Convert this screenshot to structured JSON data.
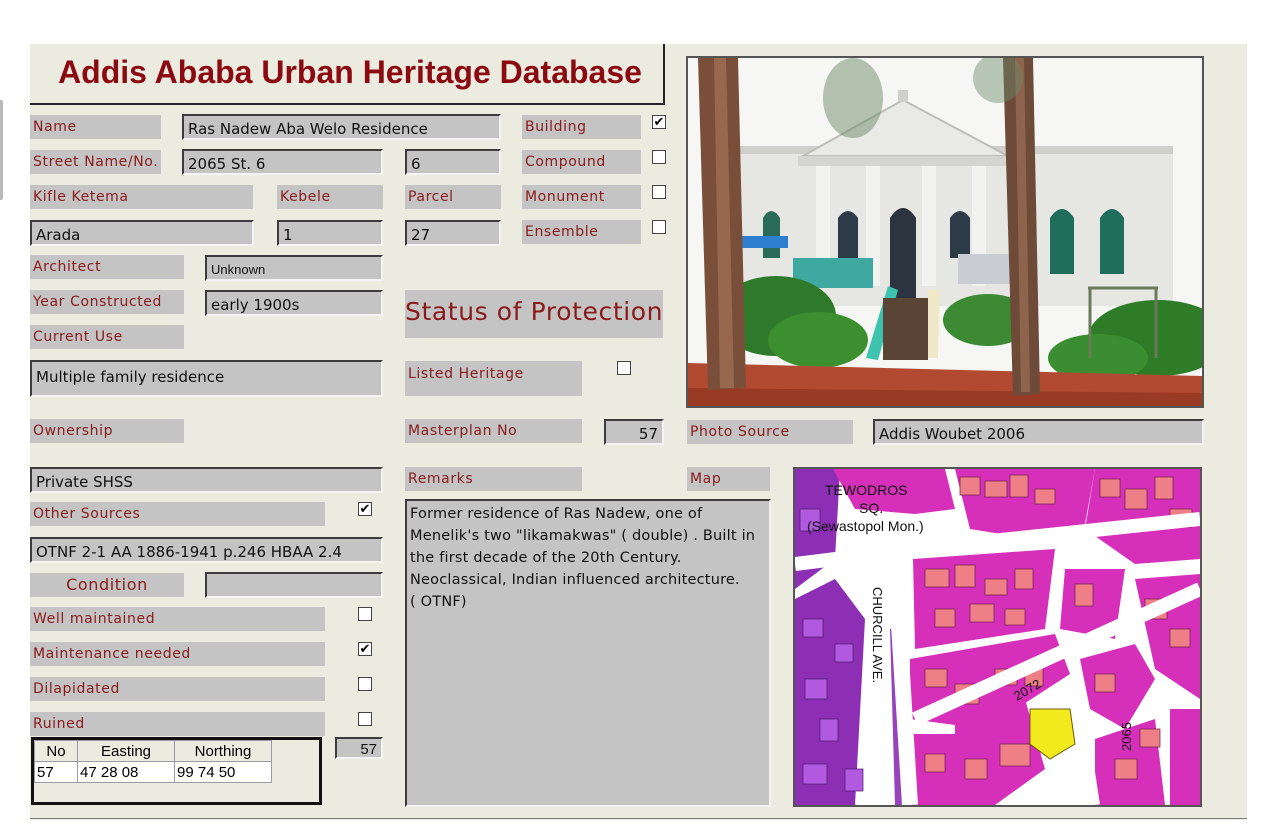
{
  "title": "Addis Ababa Urban Heritage Database",
  "fields": {
    "name": {
      "label": "Name",
      "value": "Ras Nadew Aba Welo Residence"
    },
    "street": {
      "label": "Street Name/No.",
      "value": "2065 St. 6",
      "number": "6"
    },
    "kifle_ketema": {
      "label": "Kifle Ketema",
      "value": "Arada"
    },
    "kebele": {
      "label": "Kebele",
      "value": "1"
    },
    "parcel": {
      "label": "Parcel",
      "value": "27"
    },
    "architect": {
      "label": "Architect",
      "value": "Unknown"
    },
    "year_constructed": {
      "label": "Year Constructed",
      "value": "early 1900s"
    },
    "current_use": {
      "label": "Current Use",
      "value": "Multiple family residence"
    },
    "ownership": {
      "label": "Ownership",
      "value": "Private SHSS"
    },
    "other_sources": {
      "label": "Other Sources",
      "checked": true,
      "value": "OTNF 2-1 AA 1886-1941 p.246 HBAA 2.4"
    },
    "condition": {
      "label": "Condition",
      "value": ""
    },
    "photo_source": {
      "label": "Photo Source",
      "value": "Addis Woubet 2006"
    },
    "map": {
      "label": "Map"
    },
    "masterplan_no": {
      "label": "Masterplan No",
      "value": "57"
    },
    "listed_heritage": {
      "label": "Listed Heritage",
      "checked": false
    },
    "remarks": {
      "label": "Remarks",
      "lines": [
        "Former residence of Ras Nadew, one of",
        "Menelik's two \"likamakwas\" (  double)  . Built in",
        "the first decade of the 20th Century.",
        "Neoclassical, Indian influenced architecture.",
        "(  OTNF)"
      ]
    }
  },
  "type_checks": [
    {
      "label": "Building",
      "checked": true
    },
    {
      "label": "Compound",
      "checked": false
    },
    {
      "label": "Monument",
      "checked": false
    },
    {
      "label": "Ensemble",
      "checked": false
    }
  ],
  "status_title": "Status of Protection",
  "condition_checks": [
    {
      "label": "Well maintained",
      "checked": false
    },
    {
      "label": "Maintenance needed",
      "checked": true
    },
    {
      "label": "Dilapidated",
      "checked": false
    },
    {
      "label": "Ruined",
      "checked": false
    }
  ],
  "coordinates": {
    "headers": [
      "No",
      "Easting",
      "Northing"
    ],
    "row": [
      "57",
      "47 28 08",
      "99 74 50"
    ],
    "id_field": "57"
  },
  "map_labels": {
    "square": [
      "TEWODROS",
      "SQ.",
      "(Sewastopol Mon.)"
    ],
    "avenue": "CHURCILL AVE.",
    "street_a": "2072",
    "street_b": "2065"
  },
  "colors": {
    "label_text": "#8b1a1a",
    "title_text": "#8b0a12",
    "label_bg": "#c4c4c4",
    "panel_bg": "#ecebdf",
    "map_magenta": "#d62fb9",
    "map_purple": "#8c2fb5",
    "map_salmon": "#ee7f86",
    "map_highlight": "#f2ea1d"
  }
}
